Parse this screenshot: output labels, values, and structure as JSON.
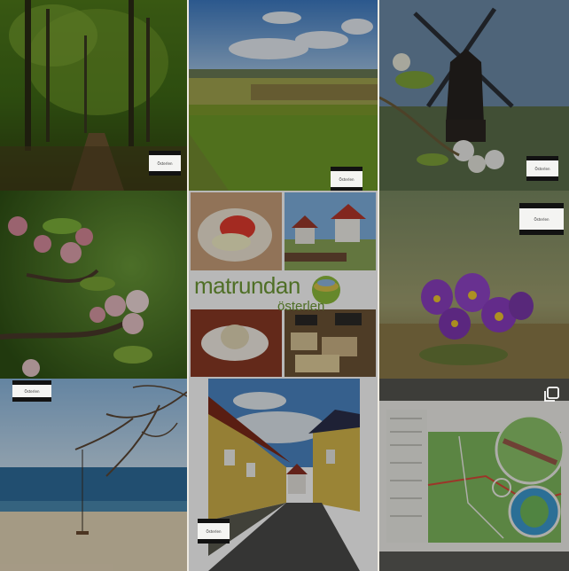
{
  "feed": {
    "items": [
      {
        "alt": "beech forest path",
        "badge": "Österlen"
      },
      {
        "alt": "spring orchard meadow",
        "badge": "Österlen"
      },
      {
        "alt": "windmill with apple blossom",
        "badge": "Österlen"
      },
      {
        "alt": "apple blossom branch"
      },
      {
        "alt": "food collage",
        "title": "matrundan",
        "subtitle": "österlen"
      },
      {
        "alt": "purple pasque flowers",
        "badge": "Österlen"
      },
      {
        "alt": "beach with swing",
        "badge": "Österlen"
      },
      {
        "alt": "cobblestone street yellow houses",
        "badge": "Österlen"
      },
      {
        "alt": "map brochure",
        "icon": "multiple-images-icon"
      }
    ]
  }
}
